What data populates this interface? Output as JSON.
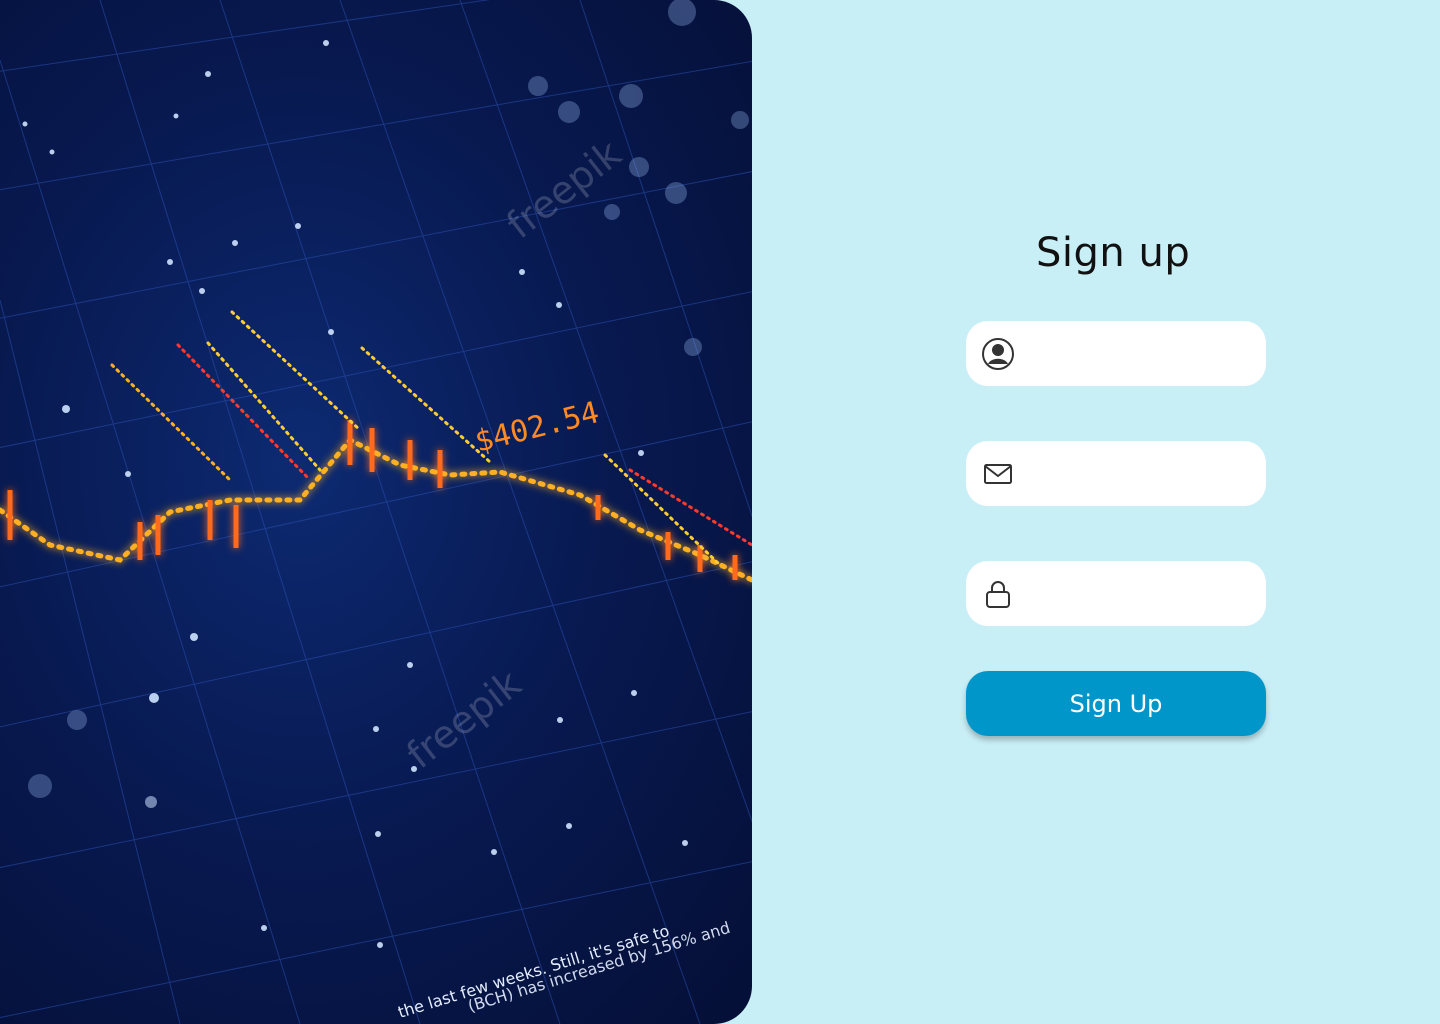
{
  "hero": {
    "price_label": "$402.54",
    "bottom_text": "the last few weeks. Still, it's safe to",
    "bottom_text_2": "(BCH) has increased by 156% and",
    "watermark": "freepik"
  },
  "form": {
    "title": "Sign up",
    "name_field": {
      "value": "",
      "placeholder": "",
      "icon": "user-icon"
    },
    "email_field": {
      "value": "",
      "placeholder": "",
      "icon": "mail-icon"
    },
    "password_field": {
      "value": "",
      "placeholder": "",
      "icon": "lock-icon"
    },
    "submit_label": "Sign Up"
  },
  "colors": {
    "background": "#c9eff6",
    "button": "#0096c9",
    "hero_dark": "#081a52",
    "chart_glow": "#ff5a1a"
  }
}
